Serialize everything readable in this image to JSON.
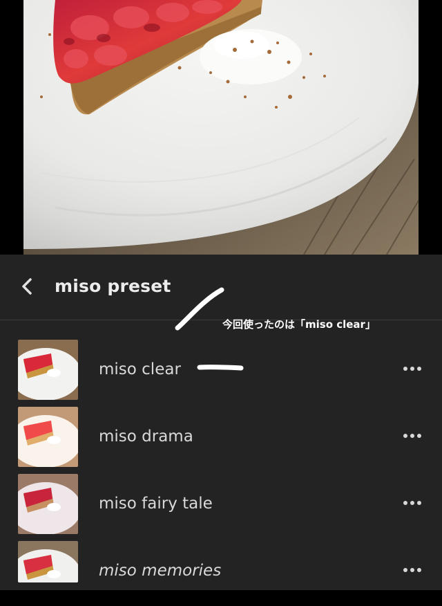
{
  "panel": {
    "title": "miso preset",
    "back_icon": "chevron-left-icon"
  },
  "annotation": {
    "text": "今回使ったのは「miso clear」",
    "color": "#ffffff"
  },
  "presets": [
    {
      "label": "miso clear",
      "tint": "clear",
      "more_icon": "more-horizontal-icon"
    },
    {
      "label": "miso drama",
      "tint": "drama",
      "more_icon": "more-horizontal-icon"
    },
    {
      "label": "miso fairy tale",
      "tint": "fairy",
      "more_icon": "more-horizontal-icon"
    },
    {
      "label": "miso memories",
      "tint": "memories",
      "more_icon": "more-horizontal-icon"
    }
  ],
  "colors": {
    "panel_bg": "#232323",
    "photo_bg": "#000000",
    "text_primary": "#ececec"
  }
}
